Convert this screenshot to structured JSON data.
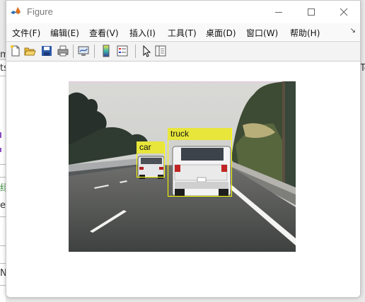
{
  "window": {
    "title": "Figure"
  },
  "menu": [
    "文件(F)",
    "编辑(E)",
    "查看(V)",
    "插入(I)",
    "工具(T)",
    "桌面(D)",
    "窗口(W)",
    "帮助(H)"
  ],
  "toolbar": {
    "items": [
      "new-figure-icon",
      "open-file-icon",
      "save-icon",
      "print-icon",
      "link-plot-icon",
      "insert-colorbar-icon",
      "insert-legend-icon",
      "edit-plot-icon",
      "property-inspector-icon"
    ]
  },
  "detections": [
    {
      "label": "car"
    },
    {
      "label": "truck"
    }
  ],
  "colors": {
    "box": "#e8e63b",
    "outline": "#ffff00"
  },
  "background_fragments": [
    "m",
    "ts",
    "Te",
    "绿",
    "eT",
    "N"
  ]
}
